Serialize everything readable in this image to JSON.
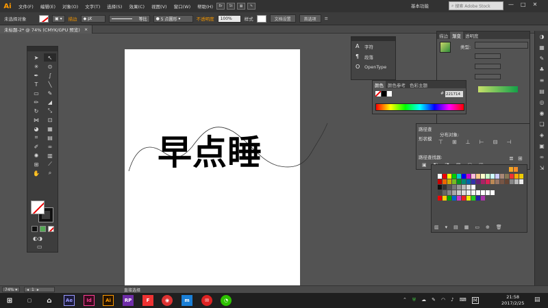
{
  "menubar": {
    "logo": "Ai",
    "items": [
      "文件(F)",
      "编辑(E)",
      "对象(O)",
      "文字(T)",
      "选择(S)",
      "效果(C)",
      "视图(V)",
      "窗口(W)",
      "帮助(H)"
    ],
    "br_label": "Br",
    "st_label": "St",
    "workspace": "基本功能",
    "search_placeholder": "搜索 Adobe Stock",
    "window_buttons": [
      "—",
      "□",
      "✕"
    ]
  },
  "controlbar": {
    "selection_label": "未选择对象",
    "stroke_label": "描边",
    "stroke_unit": "pt",
    "profile_label": "等比",
    "brush_label": "5 点圆形",
    "opacity_label": "不透明度",
    "opacity_value": "100%",
    "style_label": "样式",
    "doc_setup": "文档设置",
    "preferences": "首选项"
  },
  "tab": {
    "title": "未标题-2* @ 74% (CMYK/GPU 预览)",
    "close": "×"
  },
  "artboard": {
    "text": "早点睡"
  },
  "char_panel": {
    "items": [
      {
        "icon": "A",
        "label": "字符"
      },
      {
        "icon": "¶",
        "label": "段落"
      },
      {
        "icon": "O",
        "label": "OpenType"
      }
    ]
  },
  "color_panel": {
    "tabs": [
      "颜色",
      "颜色参考",
      "色彩主题"
    ],
    "hash": "#",
    "hex": "221714"
  },
  "stroke_panel": {
    "tabs": [
      "描边",
      "渐变",
      "透明度"
    ],
    "type_label": "类型:"
  },
  "dist_panel": {
    "path_label": "路径查",
    "shape_label": "形状模",
    "distribute_label": "分布对象:",
    "pathfinder_label": "路径查找器:"
  },
  "status": {
    "zoom": "74%",
    "page": "1",
    "tool": "直接选择"
  },
  "taskbar": {
    "apps": [
      "Ae",
      "Id",
      "Ai",
      "RP"
    ],
    "time": "21:58",
    "date": "2017/2/25",
    "ime": "M"
  },
  "colors": {
    "illustrator_orange": "#ff9a00",
    "ae_purple": "#9999ff",
    "id_pink": "#ff3d94",
    "rp_purple": "#6f2da8"
  }
}
